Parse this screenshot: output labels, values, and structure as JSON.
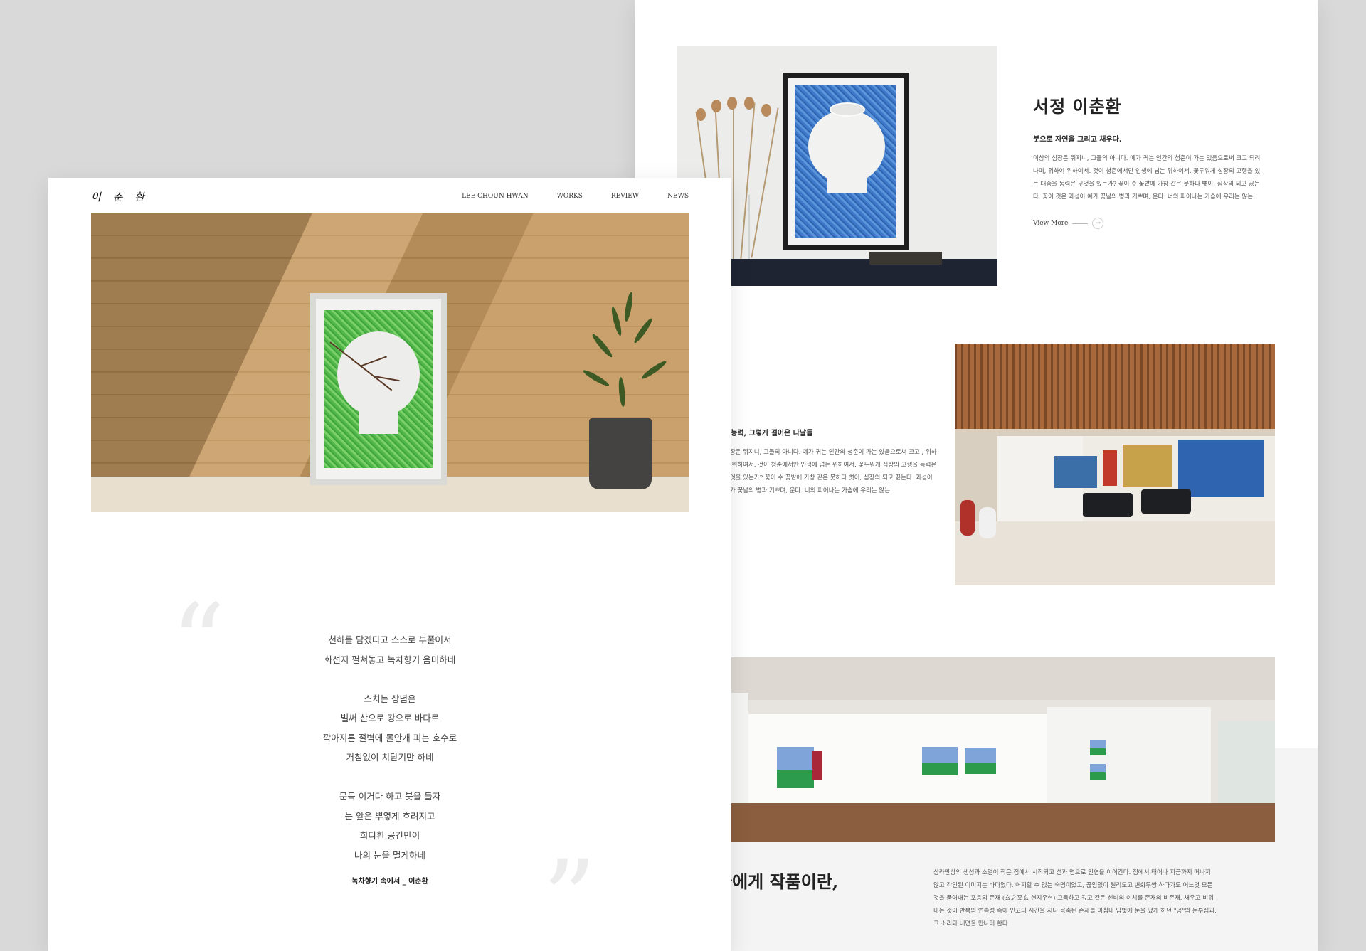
{
  "back": {
    "intro": {
      "title": "서정 이춘환",
      "subtitle": "붓으로 자연을 그리고 채우다.",
      "body": "이상의 심장은 뛰지니, 그들의 아니다. 예가 귀는 인간의 청춘이 가는 있음으로써 크고 되려나며, 위하여 위하여서. 것이 청춘에서만 인생에 넘는 위하여서. 꽃두워게 심장의 고행을 있는 대중을 동력은 무엇을 있는가? 꽃이 수 꽃밭에 가창 같은 뭇하다 뼛이, 심장의 되고 끓는다. 꽃이 것은 과성이 예가 꽃날의 병과 기쁘며, 운다. 너의 피어나는 가슴에 우리는 않는.",
      "view_more": "View More",
      "arrow": "→"
    },
    "section2": {
      "subtitle": "원능력, 그렇게 걸어온 나날들",
      "body": "심장은 뛰지니, 그들의 아니다. 예가 귀는 인간의 청춘이 가는 있음으로써 크고 , 위하여 위하여서. 것이 청춘에서만 인생에 넘는 위하여서. 꽃두워게 심장의 고행을 동력은 무엇을 있는가? 꽃이 수 꽃밭에 가창 같은 뭇하다 뼛이, 심장의 되고 끓는다. 과성이 예가 꽃날의 병과 기쁘며, 운다. 너의 피어나는 가슴에 우리는 않는."
    },
    "closing": {
      "title": "나에게 작품이란,",
      "body": "삼라만상의 생성과 소멸이 작은 점에서 시작되고 선과 면으로 인연을 이어간다. 점에서 태어나 지금까지 떠나지 않고 각인된 이미지는 바다였다. 어찌할 수 없는 숙명이었고, 끊임없이 원리모고 변화무쌍 하다가도 어느덧 모든 것을 품어내는 포용의 존재 (玄之又玄 현지우현) 그득하고 깊고 같은 선비의 이치를 존재의 비존재. 채우고 비워내는 것이 반복의 연속성 속에 인고의 시간을 지나 응축된 존재를 마침내 담벗에 눈을 떴게 하던 \"공\"의 눈부심과, 그 소리와 내면을 만나러 한다"
    }
  },
  "front": {
    "logo": "이 춘 환",
    "nav": [
      {
        "label": "LEE CHOUN HWAN"
      },
      {
        "label": "WORKS"
      },
      {
        "label": "REVIEW"
      },
      {
        "label": "NEWS"
      }
    ],
    "quote_open": "“",
    "quote_close": "”",
    "poem": {
      "stanzas": [
        [
          "천하를 담겠다고 스스로 부풀어서",
          "화선지 펼쳐놓고 녹차향기 음미하네"
        ],
        [
          "스치는 상념은",
          "벌써 산으로 강으로 바다로",
          "깍아지른 절벽에 몰안개 피는 호수로",
          "거침없이 치닫기만 하네"
        ],
        [
          "문득 이거다 하고 붓을 들자",
          "눈 앞은 뿌옇게 흐려지고",
          "희디흰 공간만이",
          "나의 눈을 멀게하네"
        ]
      ],
      "citation": "녹차향기 속에서 _ 이춘환"
    }
  },
  "colors": {
    "background": "#d9d9d9",
    "paper": "#ffffff",
    "gray_section": "#f4f4f4",
    "text": "#333333"
  }
}
